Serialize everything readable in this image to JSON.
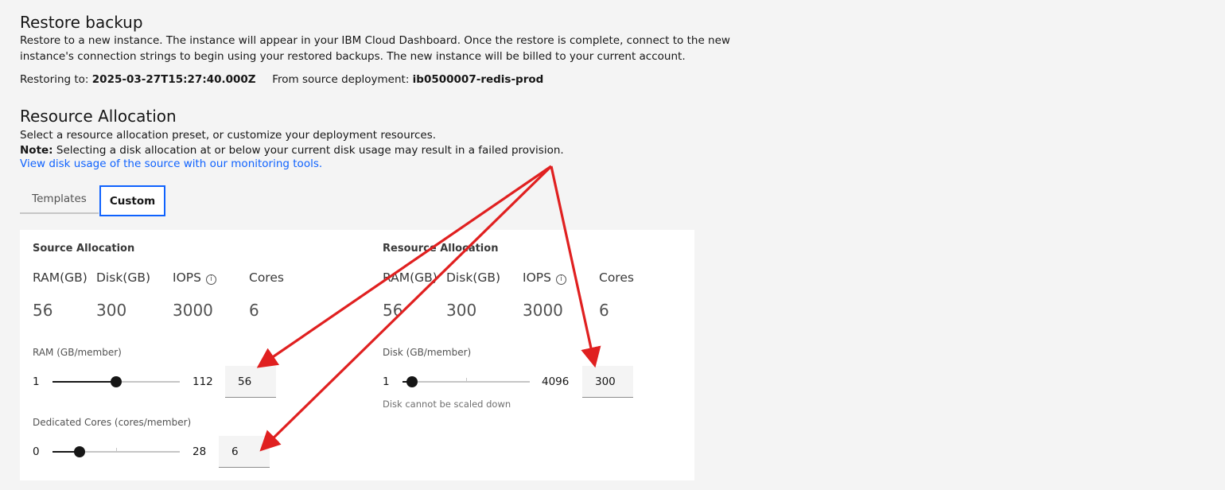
{
  "header": {
    "title": "Restore backup",
    "desc_line1": "Restore to a new instance. The instance will appear in your IBM Cloud Dashboard. Once the restore is complete, connect to the new",
    "desc_line2": "instance's connection strings to begin using your restored backups. The new instance will be billed to your current account.",
    "restoring_label": "Restoring to:",
    "restoring_value": "2025-03-27T15:27:40.000Z",
    "source_label": "From source deployment:",
    "source_value": "ib0500007-redis-prod"
  },
  "resource_allocation": {
    "title": "Resource Allocation",
    "desc": "Select a resource allocation preset, or customize your deployment resources.",
    "note_label": "Note:",
    "note_text": "Selecting a disk allocation at or below your current disk usage may result in a failed provision.",
    "link": "View disk usage of the source with our monitoring tools."
  },
  "tabs": [
    {
      "label": "Templates",
      "selected": false
    },
    {
      "label": "Custom",
      "selected": true
    }
  ],
  "source_allocation": {
    "title": "Source Allocation",
    "headers": [
      "RAM(GB)",
      "Disk(GB)",
      "IOPS",
      "Cores"
    ],
    "values": [
      "56",
      "300",
      "3000",
      "6"
    ]
  },
  "target_allocation": {
    "title": "Resource Allocation",
    "headers": [
      "RAM(GB)",
      "Disk(GB)",
      "IOPS",
      "Cores"
    ],
    "values": [
      "56",
      "300",
      "3000",
      "6"
    ]
  },
  "ram_slider": {
    "label": "RAM (GB/member)",
    "min": "1",
    "max": "112",
    "value": "56",
    "fraction": 0.5
  },
  "cores_slider": {
    "label": "Dedicated Cores (cores/member)",
    "min": "0",
    "max": "28",
    "value": "6",
    "fraction": 0.214
  },
  "disk_slider": {
    "label": "Disk (GB/member)",
    "min": "1",
    "max": "4096",
    "value": "300",
    "fraction": 0.073,
    "helper": "Disk cannot be scaled down"
  },
  "colors": {
    "accent": "#0f62fe",
    "annotation_arrow": "#e02020",
    "background": "#f4f4f4",
    "panel": "#ffffff"
  }
}
